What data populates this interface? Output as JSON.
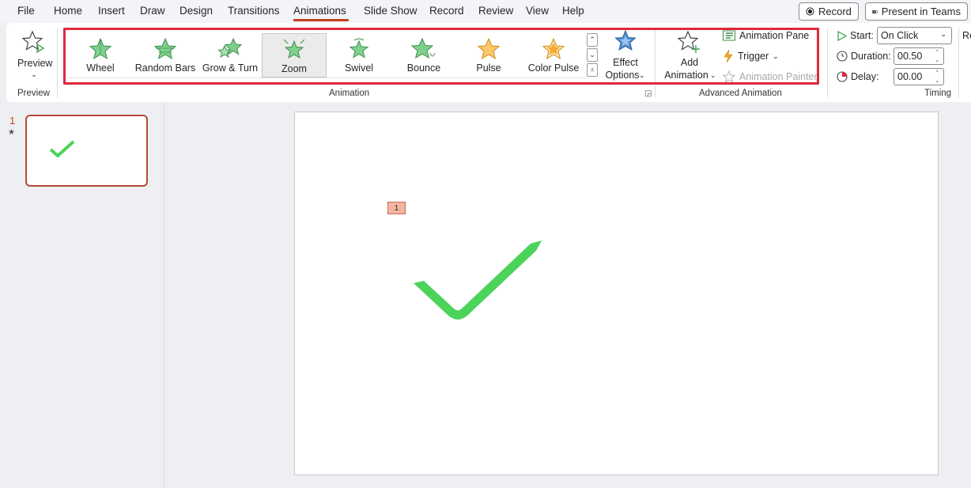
{
  "menu": {
    "tabs": [
      {
        "label": "File"
      },
      {
        "label": "Home"
      },
      {
        "label": "Insert"
      },
      {
        "label": "Draw"
      },
      {
        "label": "Design"
      },
      {
        "label": "Transitions"
      },
      {
        "label": "Animations"
      },
      {
        "label": "Slide Show"
      },
      {
        "label": "Record"
      },
      {
        "label": "Review"
      },
      {
        "label": "View"
      },
      {
        "label": "Help"
      }
    ],
    "active_tab": "Animations",
    "record_button": "Record",
    "present_button": "Present in Teams"
  },
  "ribbon": {
    "preview": {
      "button_label": "Preview",
      "group_label": "Preview"
    },
    "animation": {
      "group_label": "Animation",
      "gallery": [
        {
          "label": "Wheel",
          "icon": "wheel-star-icon",
          "color": "#4caf50"
        },
        {
          "label": "Random Bars",
          "icon": "random-bars-star-icon",
          "color": "#4caf50"
        },
        {
          "label": "Grow & Turn",
          "icon": "grow-turn-star-icon",
          "color": "#4caf50"
        },
        {
          "label": "Zoom",
          "icon": "zoom-star-icon",
          "color": "#4caf50",
          "selected": true
        },
        {
          "label": "Swivel",
          "icon": "swivel-star-icon",
          "color": "#4caf50"
        },
        {
          "label": "Bounce",
          "icon": "bounce-star-icon",
          "color": "#4caf50"
        },
        {
          "label": "Pulse",
          "icon": "pulse-star-icon",
          "color": "#f5a623"
        },
        {
          "label": "Color Pulse",
          "icon": "color-pulse-star-icon",
          "color": "#f5a623"
        }
      ],
      "effect_options_line1": "Effect",
      "effect_options_line2": "Options"
    },
    "advanced": {
      "group_label": "Advanced Animation",
      "add_animation_line1": "Add",
      "add_animation_line2": "Animation",
      "animation_pane": "Animation Pane",
      "trigger": "Trigger",
      "animation_painter": "Animation Painter"
    },
    "timing": {
      "group_label": "Timing",
      "start_label": "Start:",
      "start_value": "On Click",
      "duration_label": "Duration:",
      "duration_value": "00.50",
      "delay_label": "Delay:",
      "delay_value": "00.00",
      "cut_label": "Re"
    }
  },
  "slides": {
    "current_number": "1",
    "animation_tag": "1"
  },
  "colors": {
    "accent": "#c43e1c",
    "checkmark": "#4cd35a",
    "highlight": "#e0283a"
  }
}
